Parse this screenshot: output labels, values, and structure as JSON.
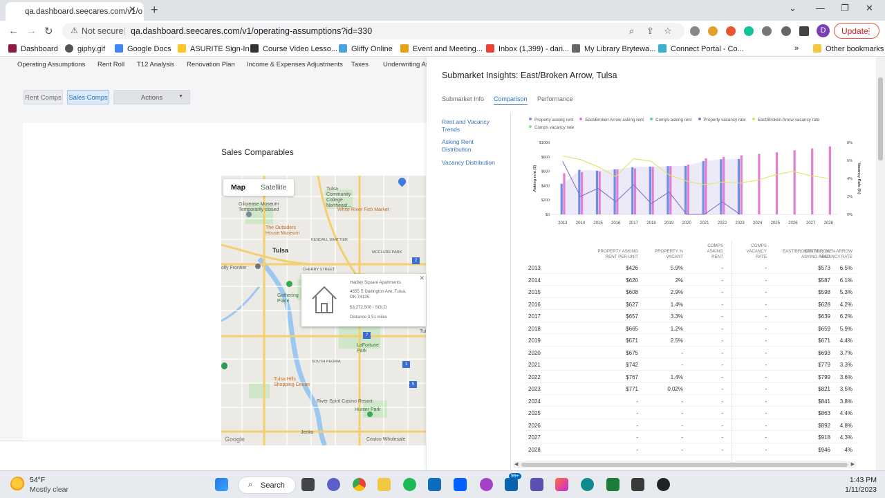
{
  "browser": {
    "tab_title": "qa.dashboard.seecares.com/v1/o",
    "not_secure": "Not secure",
    "url": "qa.dashboard.seecares.com/v1/operating-assumptions?id=330",
    "update_label": "Update",
    "profile_initial": "D",
    "bookmarks": [
      "Dashboard",
      "giphy.gif",
      "Google Docs",
      "ASURITE Sign-In",
      "Course Video Lesso...",
      "Gliffy Online",
      "Event and Meeting...",
      "Inbox (1,399) - dari...",
      "My Library Brytewa...",
      "Connect Portal - Co..."
    ],
    "overflow": "»",
    "other_bookmarks": "Other bookmarks"
  },
  "topnav": [
    "Operating Assumptions",
    "Rent Roll",
    "T12 Analysis",
    "Renovation Plan",
    "Income & Expenses Adjustments",
    "Taxes",
    "Underwriting As"
  ],
  "comp_buttons": {
    "rent": "Rent Comps",
    "sales": "Sales Comps",
    "actions": "Actions"
  },
  "sales_title": "Sales Comparables",
  "map": {
    "map_label": "Map",
    "satellite_label": "Satellite",
    "labels": {
      "tulsa_cc": "Tulsa\nCommunity\nCollege\nNortheast...",
      "gilcrease": "Gilcrease Museum\nTemporarily closed",
      "white_river": "White River Fish Market",
      "outsiders": "The Outsiders\nHouse Museum",
      "kendall": "KENDALL WHITTIER",
      "mcclure": "MCCLURE PARK",
      "tulsa": "Tulsa",
      "holly_frontier": "olly Frontier",
      "cherry": "CHERRY STREET",
      "gathering": "Gathering\nPlace",
      "lafortune": "LaFortune\nPark",
      "south_peoria": "SOUTH PEORIA",
      "tulsa_hills": "Tulsa Hills\nShopping Center",
      "river_spirit": "River Spirit Casino Resort",
      "hunter": "Hunter Park",
      "jenks": "Jenks",
      "costco": "Costco Wholesale",
      "google": "Google",
      "tul": "Tul"
    },
    "popup": {
      "name": "Hadley Square Apartments",
      "address": "4655 S Darlington Ave, Tulsa,\nOK 74135",
      "price": "$3,272,500 - SOLD",
      "distance": "Distance 3.51 miles"
    }
  },
  "panel": {
    "title": "Submarket Insights: East/Broken Arrow, Tulsa",
    "tabs": [
      "Submarket Info",
      "Comparison",
      "Performance"
    ],
    "side_nav": [
      "Rent and Vacancy\nTrends",
      "Asking Rent\nDistribution",
      "Vacancy Distribution"
    ]
  },
  "chart_data": {
    "type": "bar",
    "categories": [
      "2013",
      "2014",
      "2015",
      "2016",
      "2017",
      "2018",
      "2019",
      "2020",
      "2021",
      "2022",
      "2023",
      "2024",
      "2025",
      "2026",
      "2027",
      "2028"
    ],
    "series": [
      {
        "name": "Property asking rent",
        "type": "bar",
        "axis": "left",
        "color": "#6f8fe6",
        "values": [
          426,
          620,
          608,
          627,
          657,
          665,
          671,
          675,
          742,
          767,
          771,
          null,
          null,
          null,
          null,
          null
        ]
      },
      {
        "name": "East/Broken Arrow asking rent",
        "type": "bar",
        "axis": "left",
        "color": "#e17fd3",
        "values": [
          573,
          587,
          598,
          628,
          639,
          659,
          671,
          693,
          779,
          799,
          821,
          841,
          863,
          892,
          918,
          946
        ]
      },
      {
        "name": "Comps asking rent",
        "type": "bar",
        "axis": "left",
        "color": "#5fc6c0",
        "values": []
      },
      {
        "name": "Property vacancy rate",
        "type": "line",
        "axis": "right",
        "color": "#8e6fc9",
        "values": [
          5.9,
          2,
          2.9,
          1.4,
          3.3,
          1.2,
          2.5,
          0,
          0,
          1.4,
          0.02,
          null,
          null,
          null,
          null,
          null
        ]
      },
      {
        "name": "East/Broken Arrow vacancy rate",
        "type": "line",
        "axis": "right",
        "color": "#e6e25e",
        "values": [
          6.5,
          6.1,
          5.3,
          4.2,
          6.2,
          5.9,
          4.4,
          3.7,
          3.3,
          3.6,
          3.5,
          3.8,
          4.4,
          4.8,
          4.3,
          4
        ]
      },
      {
        "name": "Comps vacancy rate",
        "type": "line",
        "axis": "right",
        "color": "#8ee08e",
        "values": []
      }
    ],
    "ylabel": "Asking rent ($)",
    "y2label": "Vacancy Rate (%)",
    "y_ticks": [
      "$0",
      "$200",
      "$400",
      "$600",
      "$800",
      "$1000"
    ],
    "y2_ticks": [
      "0%",
      "2%",
      "4%",
      "6%",
      "8%"
    ],
    "ylim": [
      0,
      1000
    ],
    "y2lim": [
      0,
      8
    ],
    "legend_position": "top",
    "grid": false
  },
  "table": {
    "headers": [
      "PROPERTY ASKING\nRENT PER UNIT",
      "PROPERTY %\nVACANT",
      "COMPS\nASKING\nRENT",
      "COMPS\nVACANCY\nRATE",
      "EAST/BROKEN ARROW\nASKING RENT",
      "EAST/BROKEN ARROW\nVACANCY RATE"
    ],
    "rows": [
      [
        "2013",
        "$426",
        "5.9%",
        "-",
        "-",
        "$573",
        "6.5%"
      ],
      [
        "2014",
        "$620",
        "2%",
        "-",
        "-",
        "$587",
        "6.1%"
      ],
      [
        "2015",
        "$608",
        "2.9%",
        "-",
        "-",
        "$598",
        "5.3%"
      ],
      [
        "2016",
        "$627",
        "1.4%",
        "-",
        "-",
        "$628",
        "4.2%"
      ],
      [
        "2017",
        "$657",
        "3.3%",
        "-",
        "-",
        "$639",
        "6.2%"
      ],
      [
        "2018",
        "$665",
        "1.2%",
        "-",
        "-",
        "$659",
        "5.9%"
      ],
      [
        "2019",
        "$671",
        "2.5%",
        "-",
        "-",
        "$671",
        "4.4%"
      ],
      [
        "2020",
        "$675",
        "-",
        "-",
        "-",
        "$693",
        "3.7%"
      ],
      [
        "2021",
        "$742",
        "-",
        "-",
        "-",
        "$779",
        "3.3%"
      ],
      [
        "2022",
        "$767",
        "1.4%",
        "-",
        "-",
        "$799",
        "3.6%"
      ],
      [
        "2023",
        "$771",
        "0.02%",
        "-",
        "-",
        "$821",
        "3.5%"
      ],
      [
        "2024",
        "-",
        "-",
        "-",
        "-",
        "$841",
        "3.8%"
      ],
      [
        "2025",
        "-",
        "-",
        "-",
        "-",
        "$863",
        "4.4%"
      ],
      [
        "2026",
        "-",
        "-",
        "-",
        "-",
        "$892",
        "4.8%"
      ],
      [
        "2027",
        "-",
        "-",
        "-",
        "-",
        "$918",
        "4.3%"
      ],
      [
        "2028",
        "-",
        "-",
        "-",
        "-",
        "$946",
        "4%"
      ]
    ]
  },
  "taskbar": {
    "temp": "54°F",
    "weather": "Mostly clear",
    "search": "Search",
    "badge": "99+",
    "time": "1:43 PM",
    "date": "1/11/2023"
  }
}
